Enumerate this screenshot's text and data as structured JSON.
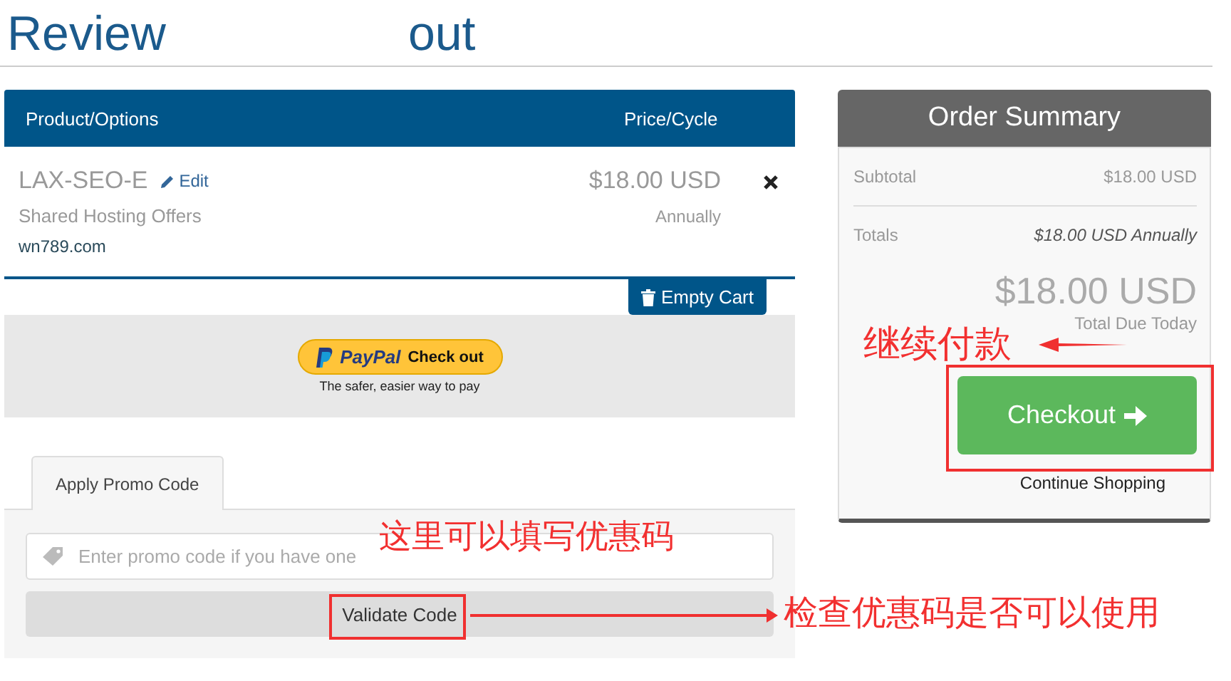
{
  "page": {
    "title_parts": [
      "Review",
      "out"
    ]
  },
  "cart": {
    "columns": [
      "Product/Options",
      "Price/Cycle"
    ],
    "items": [
      {
        "name": "LAX-SEO-E",
        "edit": "Edit",
        "group": "Shared Hosting Offers",
        "domain": "wn789.com",
        "price": "$18.00 USD",
        "cycle": "Annually"
      }
    ],
    "empty_cart": "Empty Cart"
  },
  "paypal": {
    "brand": "PayPal",
    "action": "Check out",
    "tagline": "The safer, easier way to pay"
  },
  "promo": {
    "tab": "Apply Promo Code",
    "placeholder": "Enter promo code if you have one",
    "button": "Validate Code"
  },
  "summary": {
    "title": "Order Summary",
    "rows": [
      {
        "label": "Subtotal",
        "value": "$18.00 USD",
        "kind": "plain"
      },
      {
        "label": "Totals",
        "value": "$18.00 USD Annually",
        "kind": "italic"
      }
    ],
    "total": "$18.00 USD",
    "total_label": "Total Due Today",
    "checkout": "Checkout",
    "continue": "Continue Shopping"
  },
  "annotations": [
    {
      "text": "继续付款",
      "kind": "checkout"
    },
    {
      "text": "这里可以填写优惠码",
      "kind": "field"
    },
    {
      "text": "检查优惠码是否可以使用",
      "kind": "validate"
    }
  ]
}
